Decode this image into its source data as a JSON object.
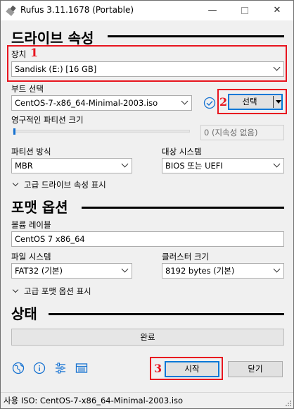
{
  "window": {
    "title": "Rufus 3.11.1678 (Portable)",
    "minimize": "—",
    "close": "✕"
  },
  "drive_section": {
    "heading": "드라이브 속성",
    "device_label": "장치",
    "device_value": "Sandisk (E:) [16 GB]",
    "boot_label": "부트 선택",
    "boot_value": "CentOS-7-x86_64-Minimal-2003.iso",
    "select_button": "선택",
    "persistent_label": "영구적인 파티션 크기",
    "persistent_value": "0 (지속성 없음)",
    "partition_label": "파티션 방식",
    "partition_value": "MBR",
    "target_label": "대상 시스템",
    "target_value": "BIOS 또는 UEFI",
    "advanced_toggle": "고급 드라이브 속성 표시"
  },
  "format_section": {
    "heading": "포맷 옵션",
    "volume_label": "볼륨 레이블",
    "volume_value": "CentOS 7 x86_64",
    "fs_label": "파일 시스템",
    "fs_value": "FAT32 (기본)",
    "cluster_label": "클러스터 크기",
    "cluster_value": "8192 bytes (기본)",
    "advanced_toggle": "고급 포맷 옵션 표시"
  },
  "status_section": {
    "heading": "상태",
    "progress_text": "완료",
    "progress_fraction": 0
  },
  "actions": {
    "start": "시작",
    "close": "닫기"
  },
  "annotations": {
    "one": "1",
    "two": "2",
    "three": "3",
    "color": "#e8151f"
  },
  "toolbar_icons": [
    "globe-icon",
    "info-icon",
    "settings-sliders-icon",
    "log-icon"
  ],
  "status_bar": {
    "text": "사용 ISO: CentOS-7-x86_64-Minimal-2003.iso"
  },
  "colors": {
    "accent": "#0078d7",
    "check": "#1672d1"
  }
}
